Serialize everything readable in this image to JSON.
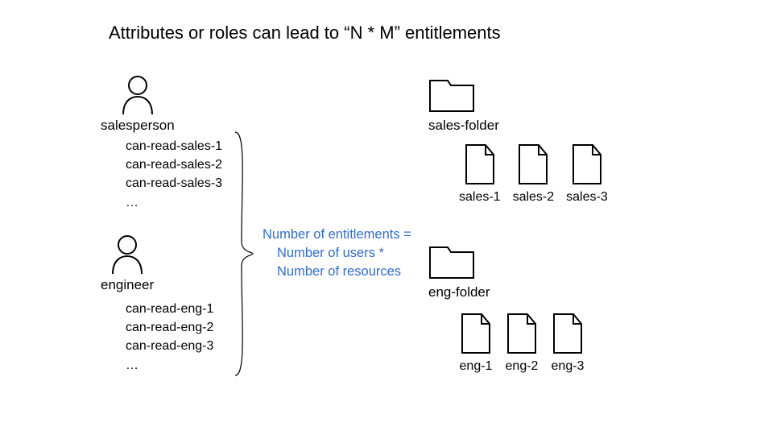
{
  "title": "Attributes or roles can lead to “N * M” entitlements",
  "users": {
    "salesperson": {
      "label": "salesperson",
      "perms": [
        "can-read-sales-1",
        "can-read-sales-2",
        "can-read-sales-3",
        "…"
      ]
    },
    "engineer": {
      "label": "engineer",
      "perms": [
        "can-read-eng-1",
        "can-read-eng-2",
        "can-read-eng-3",
        "…"
      ]
    }
  },
  "formula": {
    "line1": "Number of entitlements =",
    "line2": "Number of users *",
    "line3": "Number of resources"
  },
  "folders": {
    "sales": {
      "label": "sales-folder",
      "files": [
        "sales-1",
        "sales-2",
        "sales-3"
      ]
    },
    "eng": {
      "label": "eng-folder",
      "files": [
        "eng-1",
        "eng-2",
        "eng-3"
      ]
    }
  }
}
